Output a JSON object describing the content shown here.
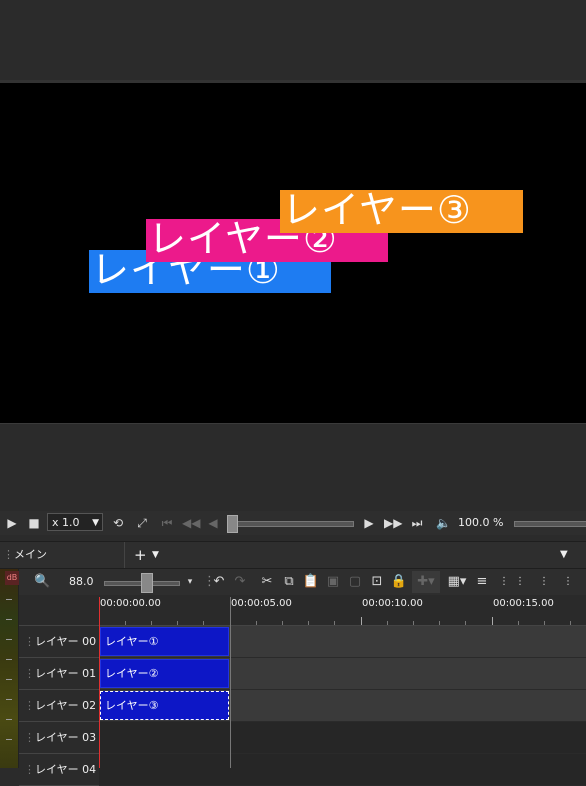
{
  "preview": {
    "layers": [
      {
        "text": "レイヤー①",
        "color": "#1e7cf2"
      },
      {
        "text": "レイヤー②",
        "color": "#ec1a8b"
      },
      {
        "text": "レイヤー③",
        "color": "#f7941d"
      }
    ]
  },
  "playback": {
    "speed": "x 1.0",
    "volume": "100.0 %"
  },
  "tabs": {
    "main_label": "メイン",
    "add_label": "+"
  },
  "toolbar": {
    "db_label": "dB",
    "zoom_value": "88.0"
  },
  "ruler": {
    "labels": [
      "00:00:00.00",
      "00:00:05.00",
      "00:00:10.00",
      "00:00:15.00"
    ]
  },
  "tracks": [
    {
      "name": "レイヤー 00",
      "clip": "レイヤー①"
    },
    {
      "name": "レイヤー 01",
      "clip": "レイヤー②"
    },
    {
      "name": "レイヤー 02",
      "clip": "レイヤー③"
    },
    {
      "name": "レイヤー 03",
      "clip": ""
    },
    {
      "name": "レイヤー 04",
      "clip": ""
    }
  ],
  "colors": {
    "clip": "#0d17c6",
    "playhead": "#e03030"
  }
}
